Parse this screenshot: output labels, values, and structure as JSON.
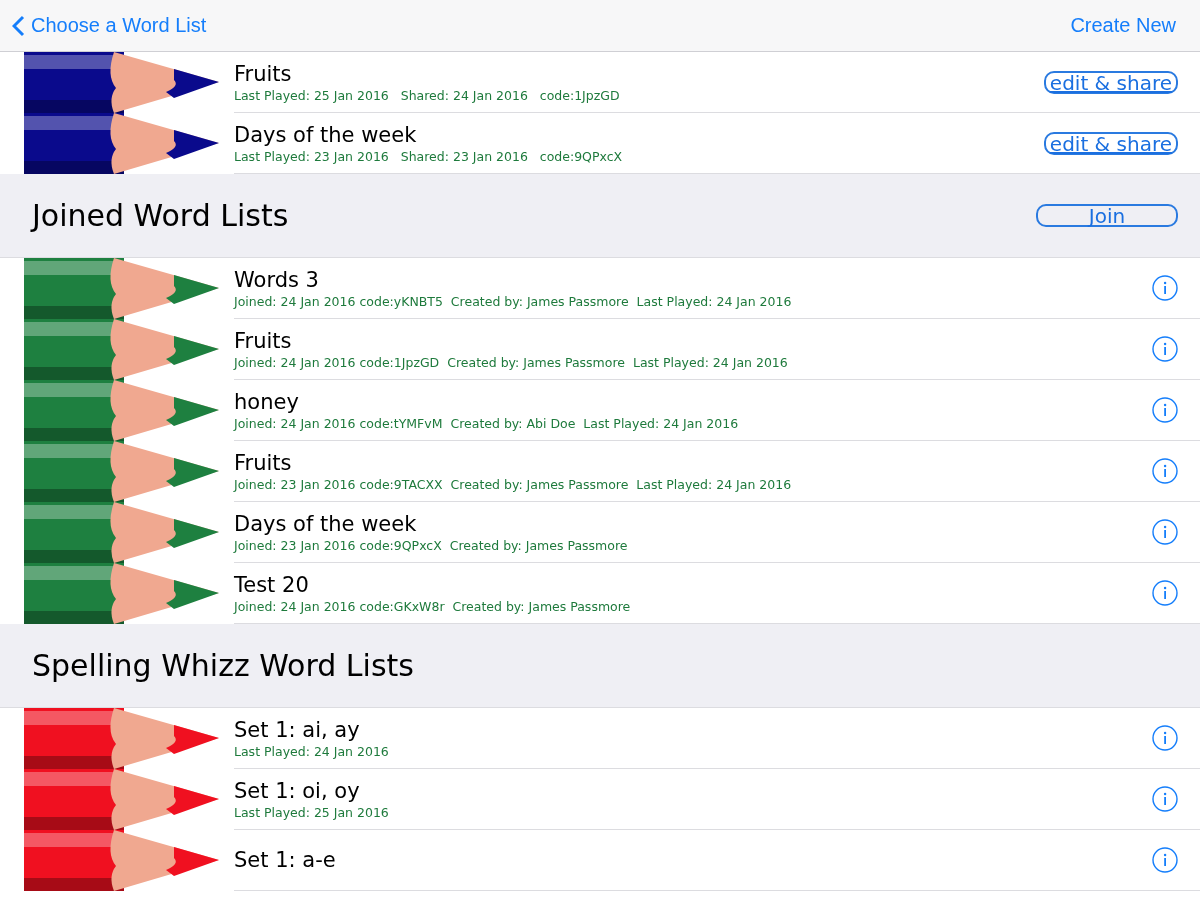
{
  "nav": {
    "back": "Choose a Word List",
    "action": "Create New"
  },
  "sections": [
    {
      "color": "#0a0a8c",
      "rows": [
        {
          "kind": "share",
          "title": "Fruits",
          "meta": "Last Played: 25 Jan 2016   Shared: 24 Jan 2016   code:1JpzGD",
          "button": "edit & share"
        },
        {
          "kind": "share",
          "title": "Days of the week",
          "meta": "Last Played: 23 Jan 2016   Shared: 23 Jan 2016   code:9QPxcX",
          "button": "edit & share"
        }
      ]
    },
    {
      "title": "Joined Word Lists",
      "color": "#1e8040",
      "button": "Join",
      "rows": [
        {
          "kind": "info",
          "title": "Words 3",
          "meta": "Joined: 24 Jan 2016 code:yKNBT5  Created by: James Passmore  Last Played: 24 Jan 2016"
        },
        {
          "kind": "info",
          "title": "Fruits",
          "meta": "Joined: 24 Jan 2016 code:1JpzGD  Created by: James Passmore  Last Played: 24 Jan 2016"
        },
        {
          "kind": "info",
          "title": "honey",
          "meta": "Joined: 24 Jan 2016 code:tYMFvM  Created by: Abi Doe  Last Played: 24 Jan 2016"
        },
        {
          "kind": "info",
          "title": "Fruits",
          "meta": "Joined: 23 Jan 2016 code:9TACXX  Created by: James Passmore  Last Played: 24 Jan 2016"
        },
        {
          "kind": "info",
          "title": "Days of the week",
          "meta": "Joined: 23 Jan 2016 code:9QPxcX  Created by: James Passmore"
        },
        {
          "kind": "info",
          "title": "Test 20",
          "meta": "Joined: 24 Jan 2016 code:GKxW8r  Created by: James Passmore"
        }
      ]
    },
    {
      "title": "Spelling Whizz Word Lists",
      "color": "#f01020",
      "rows": [
        {
          "kind": "info",
          "title": "Set 1: ai, ay",
          "meta": "Last Played: 24 Jan 2016"
        },
        {
          "kind": "info",
          "title": "Set 1: oi, oy",
          "meta": "Last Played: 25 Jan 2016"
        },
        {
          "kind": "info",
          "title": "Set 1: a-e"
        }
      ]
    }
  ]
}
